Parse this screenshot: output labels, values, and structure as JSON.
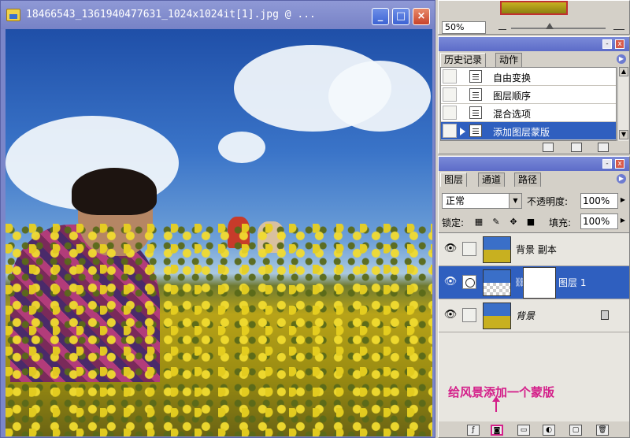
{
  "document": {
    "title": "18466543_1361940477631_1024x1024it[1].jpg @ ...",
    "buttons": {
      "minimize": "_",
      "maximize": "□",
      "close": "×"
    }
  },
  "navigator": {
    "zoom": "50%"
  },
  "history_panel": {
    "tabs": [
      {
        "label": "历史记录"
      },
      {
        "label": "动作"
      }
    ],
    "items": [
      {
        "label": "自由变换"
      },
      {
        "label": "图层顺序"
      },
      {
        "label": "混合选项"
      },
      {
        "label": "添加图层蒙版",
        "selected": true
      }
    ]
  },
  "layers_panel": {
    "tabs": [
      {
        "label": "图层"
      },
      {
        "label": "通道"
      },
      {
        "label": "路径"
      }
    ],
    "blend_mode": "正常",
    "opacity_label": "不透明度:",
    "opacity_value": "100%",
    "lock_label": "锁定:",
    "fill_label": "填充:",
    "fill_value": "100%",
    "layers": [
      {
        "name": "背景 副本",
        "visible": true
      },
      {
        "name": "图层 1",
        "visible": true,
        "selected": true,
        "has_mask": true
      },
      {
        "name": "背景",
        "visible": true,
        "locked": true
      }
    ],
    "annotation": "给风景添加一个蒙版"
  },
  "colors": {
    "title_bar": "#7b86c9",
    "selection": "#2f5fbf",
    "annotation": "#d4208a"
  }
}
